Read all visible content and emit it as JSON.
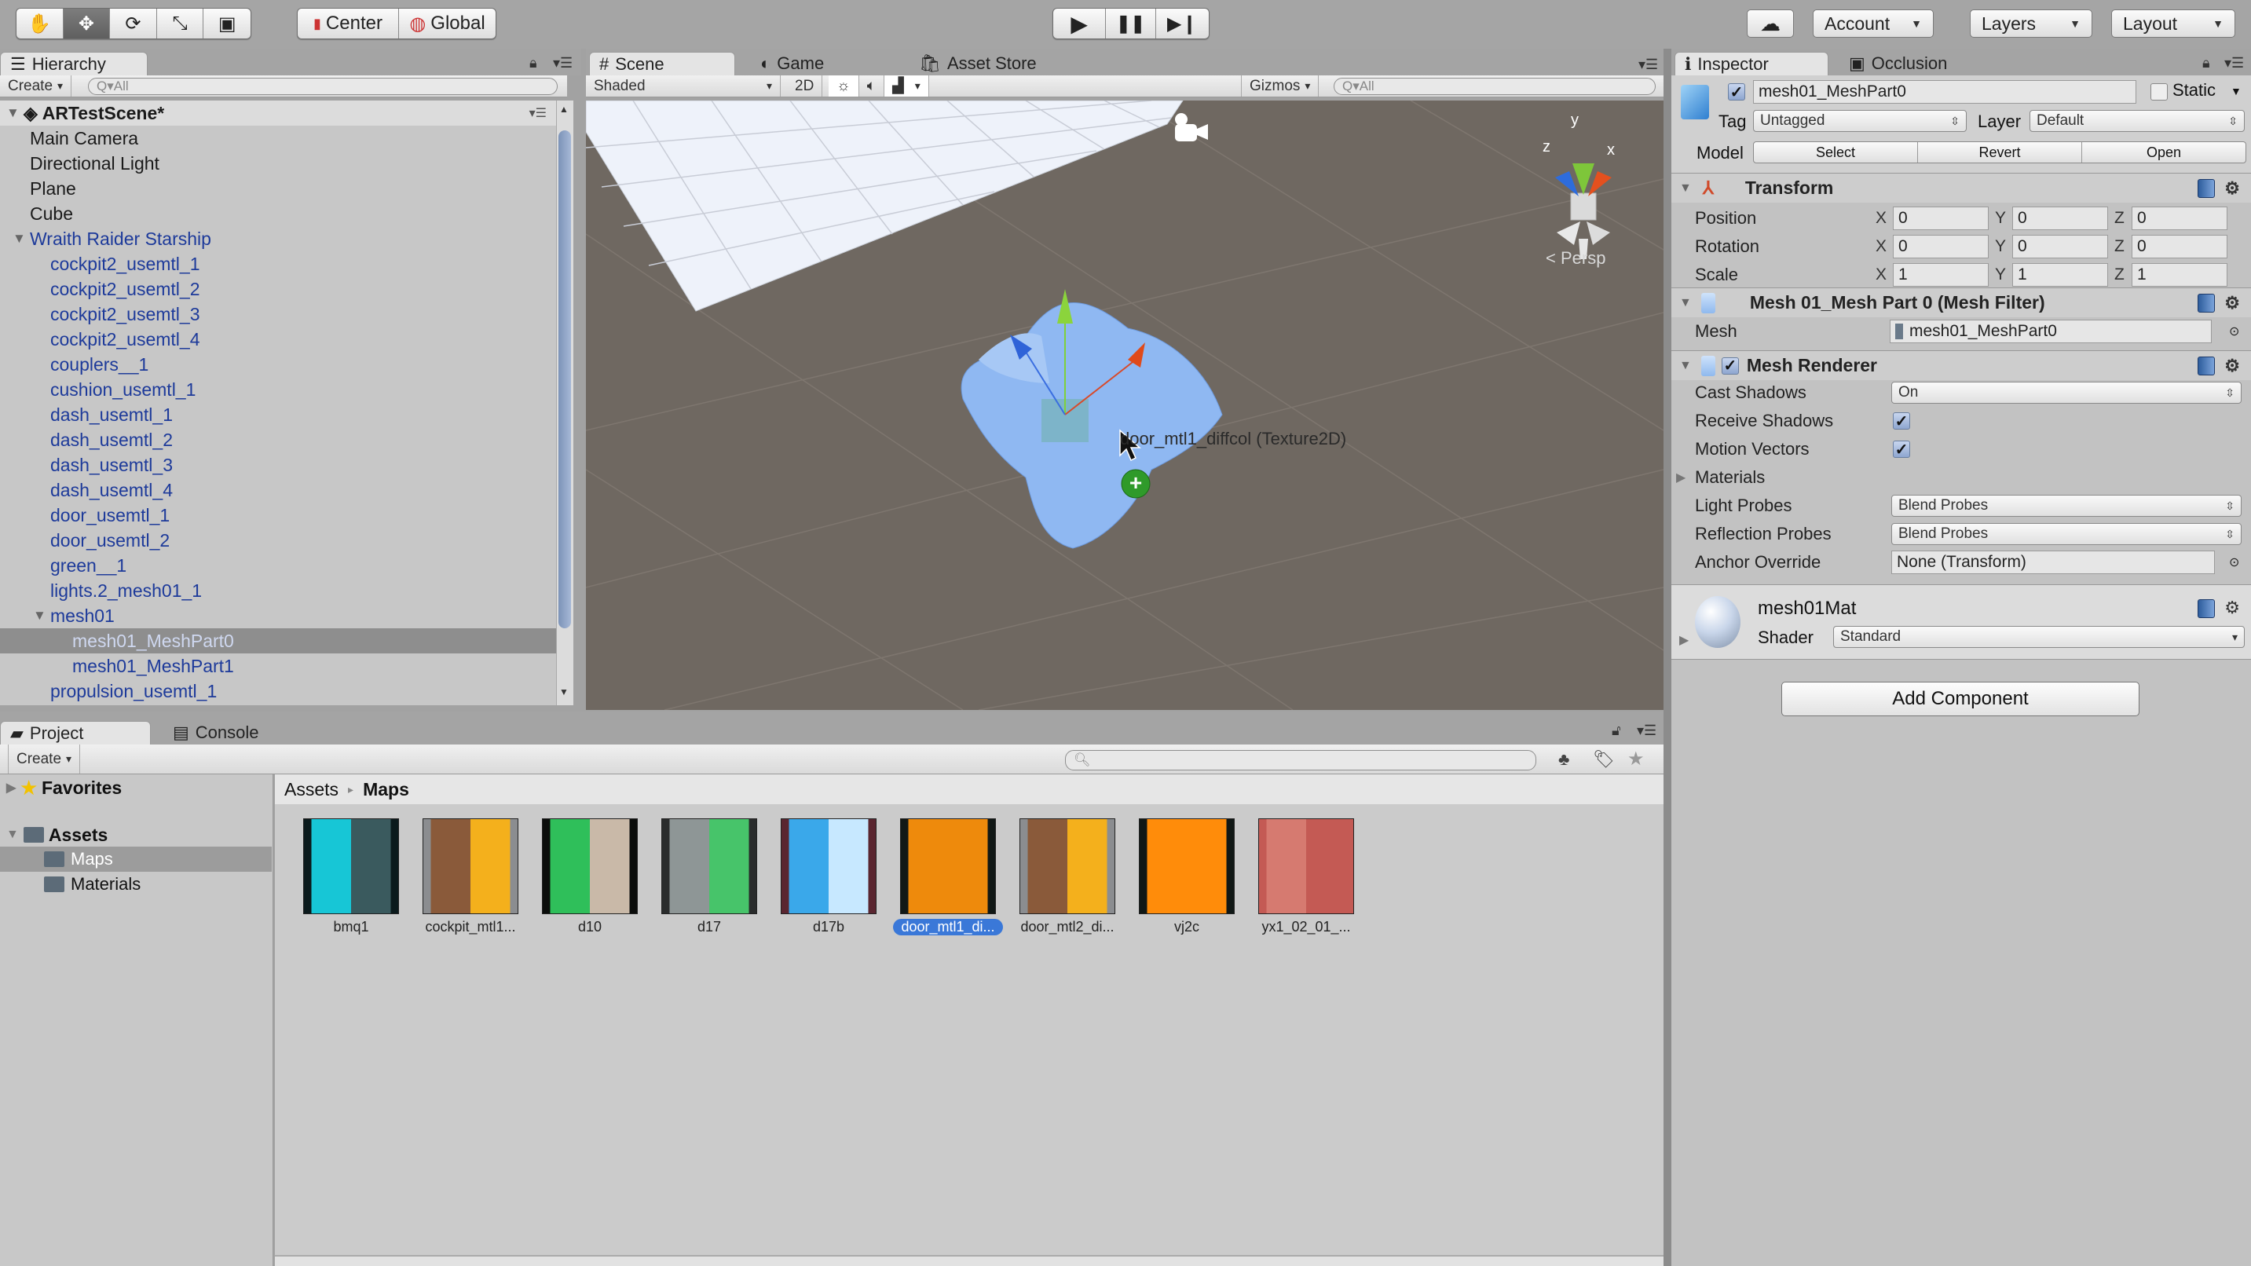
{
  "toolbar": {
    "tools": [
      {
        "name": "hand-tool",
        "glyph": "✋"
      },
      {
        "name": "move-tool",
        "glyph": "✥"
      },
      {
        "name": "rotate-tool",
        "glyph": "⟳"
      },
      {
        "name": "scale-tool",
        "glyph": "⤡"
      },
      {
        "name": "rect-tool",
        "glyph": "▣"
      }
    ],
    "pivot_label": "Center",
    "space_label": "Global",
    "play_glyph": "▶",
    "pause_glyph": "❚❚",
    "step_glyph": "▶❙",
    "cloud_glyph": "☁",
    "account_label": "Account",
    "layers_label": "Layers",
    "layout_label": "Layout"
  },
  "hierarchy": {
    "tab_label": "Hierarchy",
    "create_label": "Create",
    "search_placeholder": "Q▾All",
    "scene_name": "ARTestScene*",
    "items": [
      {
        "label": "Main Camera",
        "indent": 1,
        "blue": false
      },
      {
        "label": "Directional Light",
        "indent": 1,
        "blue": false
      },
      {
        "label": "Plane",
        "indent": 1,
        "blue": false
      },
      {
        "label": "Cube",
        "indent": 1,
        "blue": false
      },
      {
        "label": "Wraith Raider Starship",
        "indent": 1,
        "blue": true,
        "expanded": true
      },
      {
        "label": "cockpit2_usemtl_1",
        "indent": 2,
        "blue": true
      },
      {
        "label": "cockpit2_usemtl_2",
        "indent": 2,
        "blue": true
      },
      {
        "label": "cockpit2_usemtl_3",
        "indent": 2,
        "blue": true
      },
      {
        "label": "cockpit2_usemtl_4",
        "indent": 2,
        "blue": true
      },
      {
        "label": "couplers__1",
        "indent": 2,
        "blue": true
      },
      {
        "label": "cushion_usemtl_1",
        "indent": 2,
        "blue": true
      },
      {
        "label": "dash_usemtl_1",
        "indent": 2,
        "blue": true
      },
      {
        "label": "dash_usemtl_2",
        "indent": 2,
        "blue": true
      },
      {
        "label": "dash_usemtl_3",
        "indent": 2,
        "blue": true
      },
      {
        "label": "dash_usemtl_4",
        "indent": 2,
        "blue": true
      },
      {
        "label": "door_usemtl_1",
        "indent": 2,
        "blue": true
      },
      {
        "label": "door_usemtl_2",
        "indent": 2,
        "blue": true
      },
      {
        "label": "green__1",
        "indent": 2,
        "blue": true
      },
      {
        "label": "lights.2_mesh01_1",
        "indent": 2,
        "blue": true
      },
      {
        "label": "mesh01",
        "indent": 2,
        "blue": true,
        "expanded": true
      },
      {
        "label": "mesh01_MeshPart0",
        "indent": 3,
        "blue": true,
        "selected": true
      },
      {
        "label": "mesh01_MeshPart1",
        "indent": 3,
        "blue": true
      },
      {
        "label": "propulsion_usemtl_1",
        "indent": 2,
        "blue": true
      }
    ]
  },
  "scene": {
    "tabs": [
      {
        "label": "Scene",
        "icon": "#",
        "active": true
      },
      {
        "label": "Game",
        "icon": "◐",
        "active": false
      },
      {
        "label": "Asset Store",
        "icon": "🛍",
        "active": false
      }
    ],
    "draw_mode": "Shaded",
    "mode_2d": "2D",
    "gizmos_label": "Gizmos",
    "search_placeholder": "Q▾All",
    "persp_label": "< Persp",
    "axis_labels": {
      "x": "x",
      "y": "y",
      "z": "z"
    },
    "drag_tooltip": "door_mtl1_diffcol (Texture2D)"
  },
  "inspector": {
    "tabs": [
      {
        "label": "Inspector",
        "icon": "ℹ",
        "active": true
      },
      {
        "label": "Occlusion",
        "icon": "▣",
        "active": false
      }
    ],
    "object_name": "mesh01_MeshPart0",
    "active": true,
    "static_label": "Static",
    "static": false,
    "tag_label": "Tag",
    "tag_value": "Untagged",
    "layer_label": "Layer",
    "layer_value": "Default",
    "model_label": "Model",
    "model_buttons": [
      "Select",
      "Revert",
      "Open"
    ],
    "transform": {
      "title": "Transform",
      "rows": [
        {
          "label": "Position",
          "x": "0",
          "y": "0",
          "z": "0"
        },
        {
          "label": "Rotation",
          "x": "0",
          "y": "0",
          "z": "0"
        },
        {
          "label": "Scale",
          "x": "1",
          "y": "1",
          "z": "1"
        }
      ]
    },
    "mesh_filter": {
      "title": "Mesh 01_Mesh Part 0 (Mesh Filter)",
      "mesh_label": "Mesh",
      "mesh_value": "mesh01_MeshPart0"
    },
    "mesh_renderer": {
      "title": "Mesh Renderer",
      "enabled": true,
      "cast_shadows_label": "Cast Shadows",
      "cast_shadows_value": "On",
      "receive_shadows_label": "Receive Shadows",
      "receive_shadows": true,
      "motion_vectors_label": "Motion Vectors",
      "motion_vectors": true,
      "materials_label": "Materials",
      "light_probes_label": "Light Probes",
      "light_probes_value": "Blend Probes",
      "reflection_probes_label": "Reflection Probes",
      "reflection_probes_value": "Blend Probes",
      "anchor_override_label": "Anchor Override",
      "anchor_override_value": "None (Transform)"
    },
    "material": {
      "name": "mesh01Mat",
      "shader_label": "Shader",
      "shader_value": "Standard"
    },
    "add_component_label": "Add Component"
  },
  "project": {
    "tabs": [
      {
        "label": "Project",
        "active": true
      },
      {
        "label": "Console",
        "active": false
      }
    ],
    "create_label": "Create",
    "favorites_label": "Favorites",
    "assets_label": "Assets",
    "folders": [
      {
        "label": "Maps",
        "selected": true
      },
      {
        "label": "Materials",
        "selected": false
      }
    ],
    "breadcrumb": [
      "Assets",
      "Maps"
    ],
    "assets": [
      {
        "label": "bmq1",
        "colors": [
          "#0b1a1c",
          "#17c6d6",
          "#3a5a5e"
        ]
      },
      {
        "label": "cockpit_mtl1...",
        "colors": [
          "#8b8d90",
          "#8a5a3a",
          "#f4b01c"
        ]
      },
      {
        "label": "d10",
        "colors": [
          "#0b0d0b",
          "#2fbf5a",
          "#c9b9a8"
        ]
      },
      {
        "label": "d17",
        "colors": [
          "#2a2c2c",
          "#8e9696",
          "#47c46a"
        ]
      },
      {
        "label": "d17b",
        "colors": [
          "#5a2630",
          "#3aa8ea",
          "#c7e8ff"
        ]
      },
      {
        "label": "door_mtl1_di...",
        "colors": [
          "#111816",
          "#ee8a0c",
          "#ee8a0c"
        ],
        "selected": true
      },
      {
        "label": "door_mtl2_di...",
        "colors": [
          "#8b8d90",
          "#8a5a3a",
          "#f4b01c"
        ]
      },
      {
        "label": "vj2c",
        "colors": [
          "#111816",
          "#ff8c0a",
          "#ff8c0a"
        ]
      },
      {
        "label": "yx1_02_01_...",
        "colors": [
          "#c45a54",
          "#d67a70",
          "#c45a54"
        ]
      }
    ]
  }
}
